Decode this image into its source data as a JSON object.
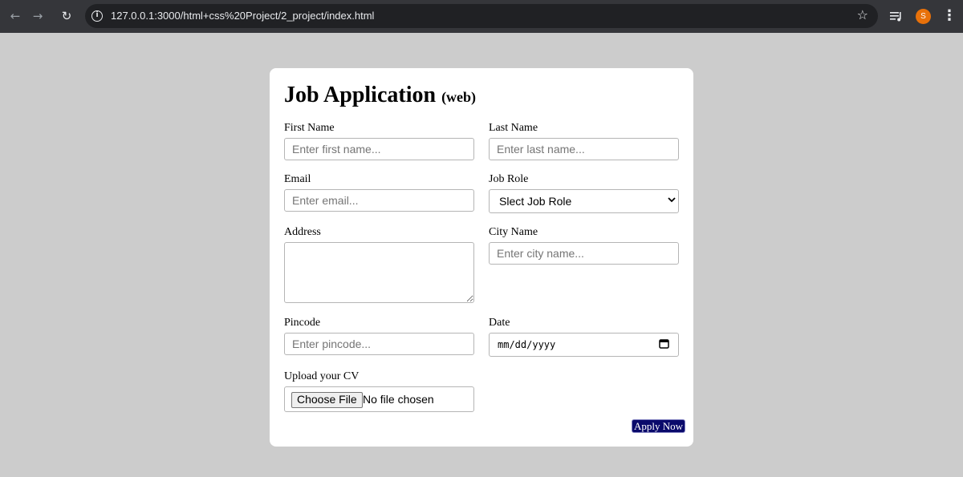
{
  "browser": {
    "url": "127.0.0.1:3000/html+css%20Project/2_project/index.html",
    "avatar_letter": "S"
  },
  "form": {
    "title": "Job Application",
    "subtitle": "(web)",
    "first_name": {
      "label": "First Name",
      "placeholder": "Enter first name..."
    },
    "last_name": {
      "label": "Last Name",
      "placeholder": "Enter last name..."
    },
    "email": {
      "label": "Email",
      "placeholder": "Enter email..."
    },
    "job_role": {
      "label": "Job Role",
      "selected": "Slect Job Role"
    },
    "address": {
      "label": "Address"
    },
    "city": {
      "label": "City Name",
      "placeholder": "Enter city name..."
    },
    "pincode": {
      "label": "Pincode",
      "placeholder": "Enter pincode..."
    },
    "date": {
      "label": "Date",
      "value": "mm/dd/yyyy"
    },
    "cv": {
      "label": "Upload your CV",
      "button": "Choose File",
      "status": "No file chosen"
    },
    "submit": "Apply Now"
  },
  "colors": {
    "page_bg": "#cccccc",
    "toolbar_bg": "#35363a",
    "omnibox_bg": "#202124",
    "avatar": "#e8710a",
    "submit_bg": "#0a0a6b"
  }
}
